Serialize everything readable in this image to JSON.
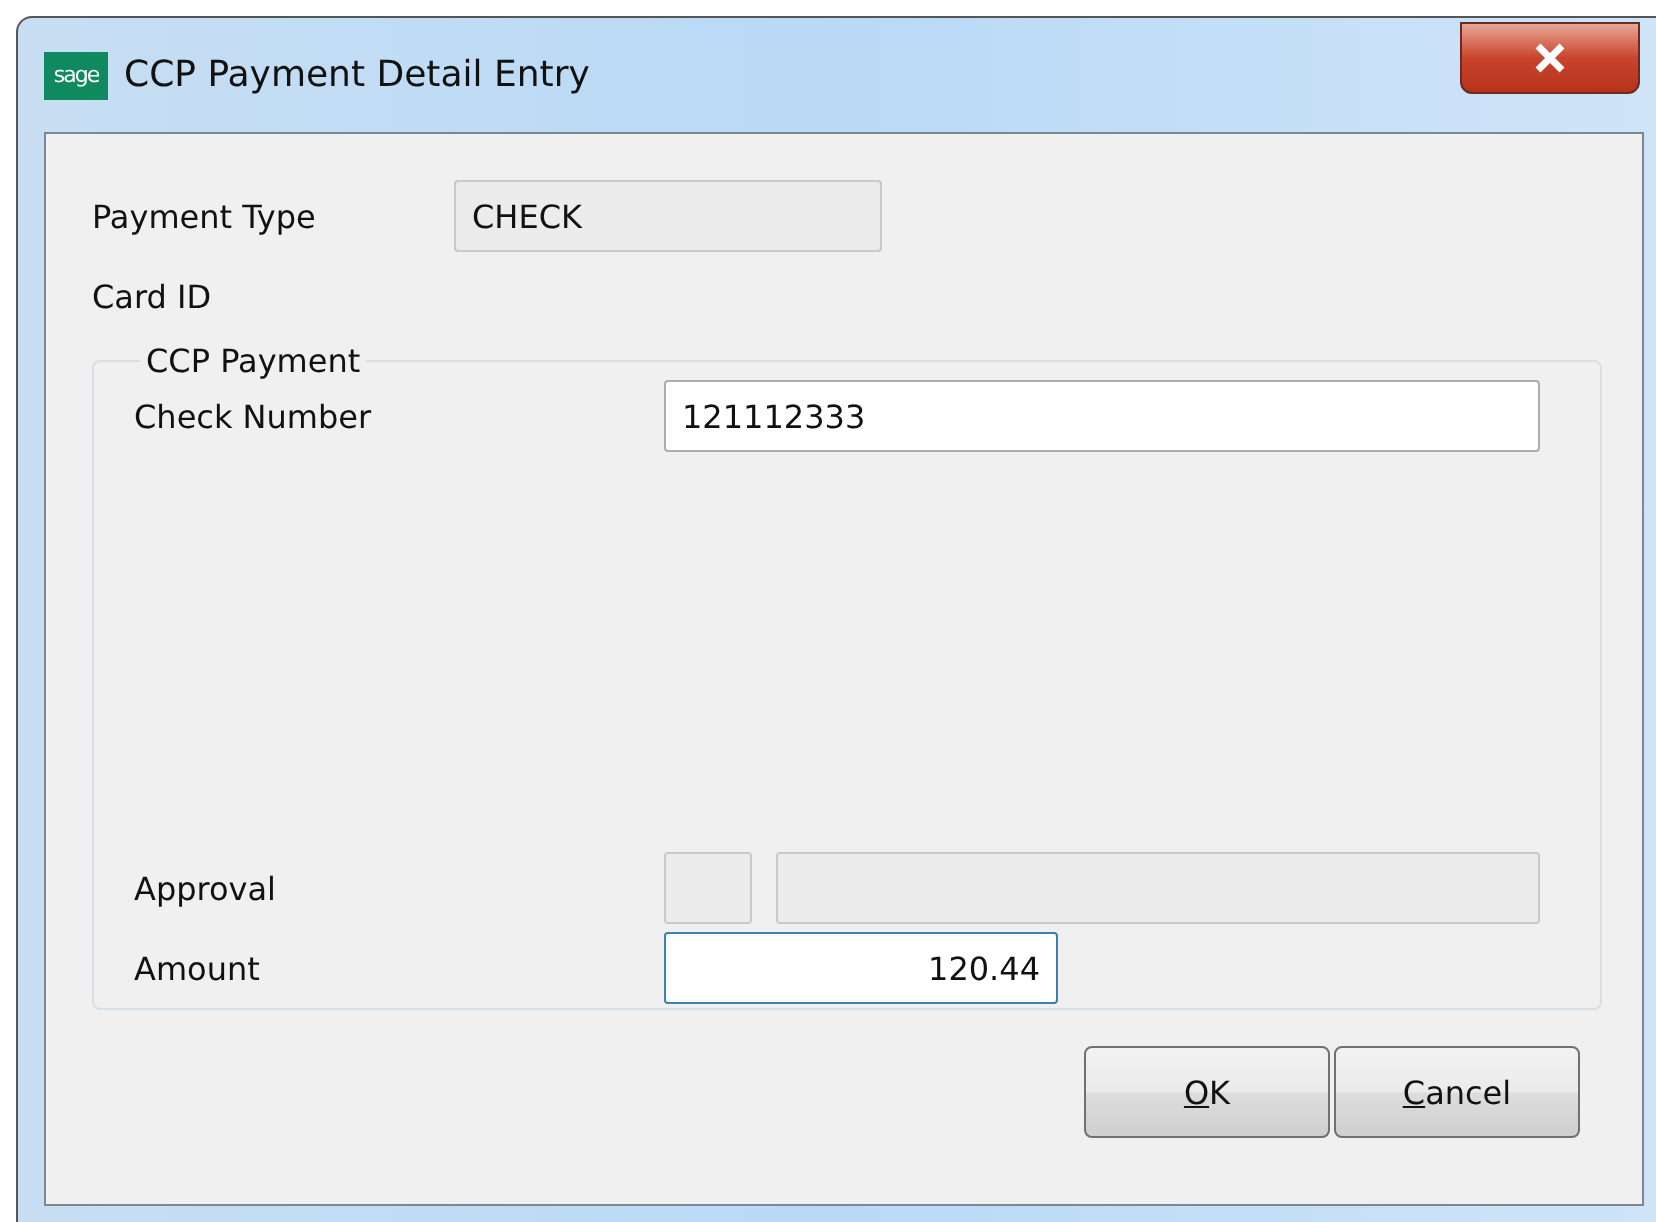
{
  "window": {
    "title": "CCP Payment Detail Entry",
    "logo": "sage"
  },
  "header_fields": [
    {
      "label": "Payment Type",
      "value": "CHECK",
      "kind": "readonly"
    },
    {
      "label": "Card ID",
      "kind": "none"
    }
  ],
  "group": {
    "title": "CCP Payment",
    "check_number": {
      "label": "Check Number",
      "value": "121112333"
    },
    "approval": {
      "label": "Approval"
    },
    "amount": {
      "label": "Amount",
      "value": "120.44",
      "focused": true
    }
  },
  "buttons": [
    {
      "label": "OK"
    },
    {
      "label": "Cancel"
    }
  ]
}
